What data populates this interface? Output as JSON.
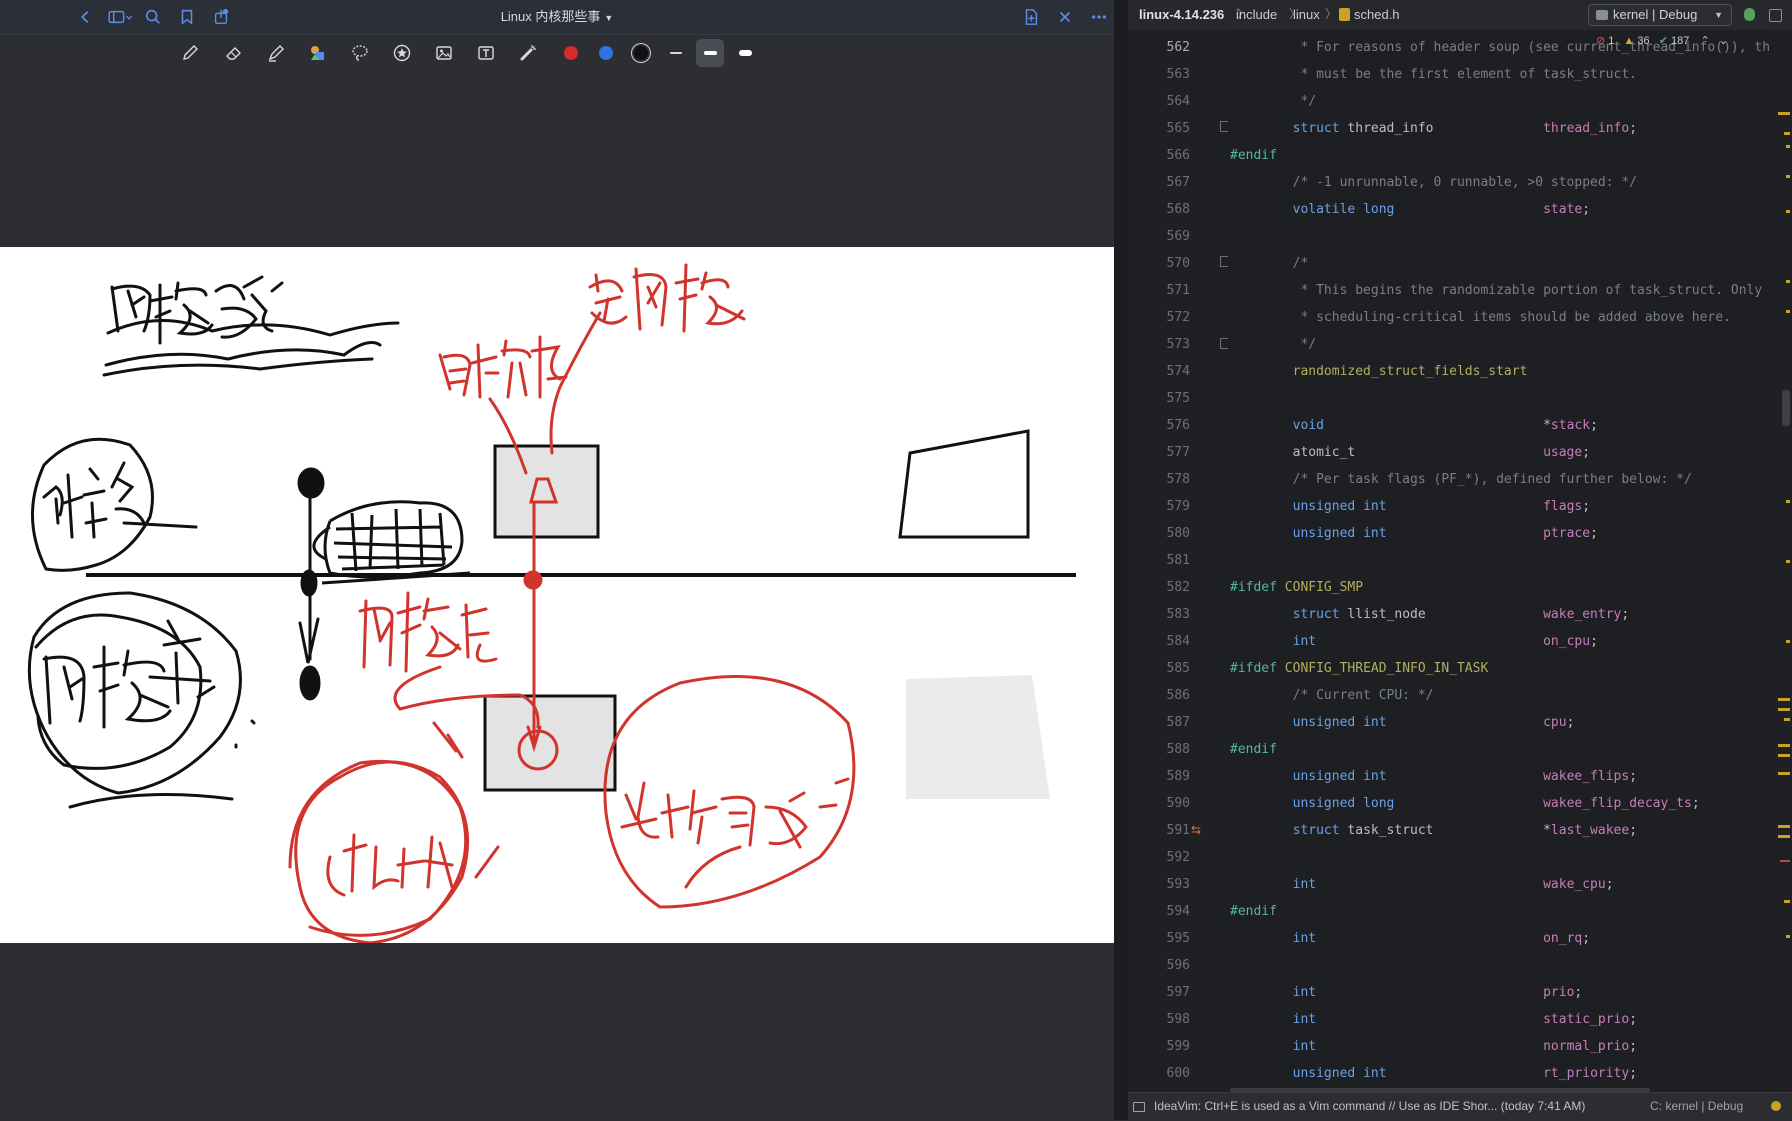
{
  "notes": {
    "title": "Linux 内核那些事",
    "toolbar_tools": [
      "pen-tool",
      "eraser-tool",
      "highlighter-tool",
      "shapes-tool",
      "lasso-tool",
      "sticker-tool",
      "image-tool",
      "text-tool",
      "laser-pointer-tool"
    ],
    "colors": [
      "#d92a2a",
      "#2f74e0",
      "#111111"
    ],
    "stroke_widths": [
      "thin",
      "medium",
      "thick"
    ]
  },
  "ide": {
    "breadcrumb": {
      "project": "linux-4.14.236",
      "dir1": "include",
      "dir2": "linux",
      "file": "sched.h"
    },
    "run_config": "kernel | Debug",
    "inspections": {
      "errors": "1",
      "warnings": "36",
      "ok": "187"
    },
    "code_lines": [
      {
        "n": "562",
        "text": "         * For reasons of header soup (see current_thread_info()), this"
      },
      {
        "n": "563",
        "text": "         * must be the first element of task_struct."
      },
      {
        "n": "564",
        "text": "         */"
      },
      {
        "n": "565",
        "text": "        struct thread_info              thread_info;"
      },
      {
        "n": "566",
        "text": "#endif"
      },
      {
        "n": "567",
        "text": "        /* -1 unrunnable, 0 runnable, >0 stopped: */"
      },
      {
        "n": "568",
        "text": "        volatile long                   state;"
      },
      {
        "n": "569",
        "text": ""
      },
      {
        "n": "570",
        "text": "        /*"
      },
      {
        "n": "571",
        "text": "         * This begins the randomizable portion of task_struct. Only"
      },
      {
        "n": "572",
        "text": "         * scheduling-critical items should be added above here."
      },
      {
        "n": "573",
        "text": "         */"
      },
      {
        "n": "574",
        "text": "        randomized_struct_fields_start"
      },
      {
        "n": "575",
        "text": ""
      },
      {
        "n": "576",
        "text": "        void                            *stack;"
      },
      {
        "n": "577",
        "text": "        atomic_t                        usage;"
      },
      {
        "n": "578",
        "text": "        /* Per task flags (PF_*), defined further below: */"
      },
      {
        "n": "579",
        "text": "        unsigned int                    flags;"
      },
      {
        "n": "580",
        "text": "        unsigned int                    ptrace;"
      },
      {
        "n": "581",
        "text": ""
      },
      {
        "n": "582",
        "text": "#ifdef CONFIG_SMP"
      },
      {
        "n": "583",
        "text": "        struct llist_node               wake_entry;"
      },
      {
        "n": "584",
        "text": "        int                             on_cpu;"
      },
      {
        "n": "585",
        "text": "#ifdef CONFIG_THREAD_INFO_IN_TASK"
      },
      {
        "n": "586",
        "text": "        /* Current CPU: */"
      },
      {
        "n": "587",
        "text": "        unsigned int                    cpu;"
      },
      {
        "n": "588",
        "text": "#endif"
      },
      {
        "n": "589",
        "text": "        unsigned int                    wakee_flips;"
      },
      {
        "n": "590",
        "text": "        unsigned long                   wakee_flip_decay_ts;"
      },
      {
        "n": "591",
        "text": "        struct task_struct              *last_wakee;"
      },
      {
        "n": "592",
        "text": ""
      },
      {
        "n": "593",
        "text": "        int                             wake_cpu;"
      },
      {
        "n": "594",
        "text": "#endif"
      },
      {
        "n": "595",
        "text": "        int                             on_rq;"
      },
      {
        "n": "596",
        "text": ""
      },
      {
        "n": "597",
        "text": "        int                             prio;"
      },
      {
        "n": "598",
        "text": "        int                             static_prio;"
      },
      {
        "n": "599",
        "text": "        int                             normal_prio;"
      },
      {
        "n": "600",
        "text": "        unsigned int                    rt_priority;"
      }
    ],
    "status_message": "IdeaVim: Ctrl+E is used as a Vim command // Use as IDE Shor... (today 7:41 AM)",
    "status_right": "C: kernel | Debug"
  }
}
